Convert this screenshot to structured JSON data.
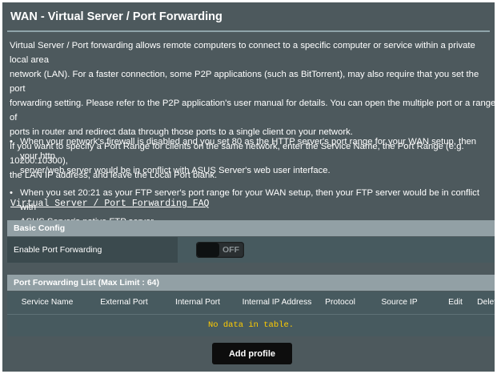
{
  "page": {
    "title": "WAN - Virtual Server / Port Forwarding",
    "description_lines": [
      "Virtual Server / Port forwarding allows remote computers to connect to a specific computer or service within a private local area",
      "network (LAN). For a faster connection, some P2P applications (such as BitTorrent), may also require that you set the port",
      "forwarding setting. Please refer to the P2P application's user manual for details. You can open the multiple port or a range of",
      "ports in router and redirect data through those ports to a single client on your network.",
      "If you want to specify a Port Range for clients on the same network, enter the Service Name, the Port Range (e.g. 10200:10300),",
      "the LAN IP address, and leave the Local Port blank."
    ],
    "bullets": [
      {
        "line1": "When your network's firewall is disabled and you set 80 as the HTTP server's port range for your WAN setup, then your http",
        "line2": "server/web server would be in conflict with ASUS Server's web user interface."
      },
      {
        "line1": "When you set 20:21 as your FTP server's port range for your WAN setup, then your FTP server would be in conflict with",
        "line2": "ASUS Server's native FTP server."
      }
    ],
    "bullet_glyph": "•",
    "faq_link": "Virtual Server / Port Forwarding FAQ"
  },
  "basic_config": {
    "header": "Basic Config",
    "enable_label": "Enable Port Forwarding",
    "toggle_state": "OFF"
  },
  "list": {
    "header": "Port Forwarding List (Max Limit : 64)",
    "columns": [
      "Service Name",
      "External Port",
      "Internal Port",
      "Internal IP Address",
      "Protocol",
      "Source IP",
      "Edit",
      "Delete"
    ],
    "empty_message": "No data in table."
  },
  "add_profile_label": "Add profile",
  "colors": {
    "panel_bg": "#4d595d",
    "section_header_bg": "#92a0a5",
    "empty_text": "#ffcc00"
  }
}
